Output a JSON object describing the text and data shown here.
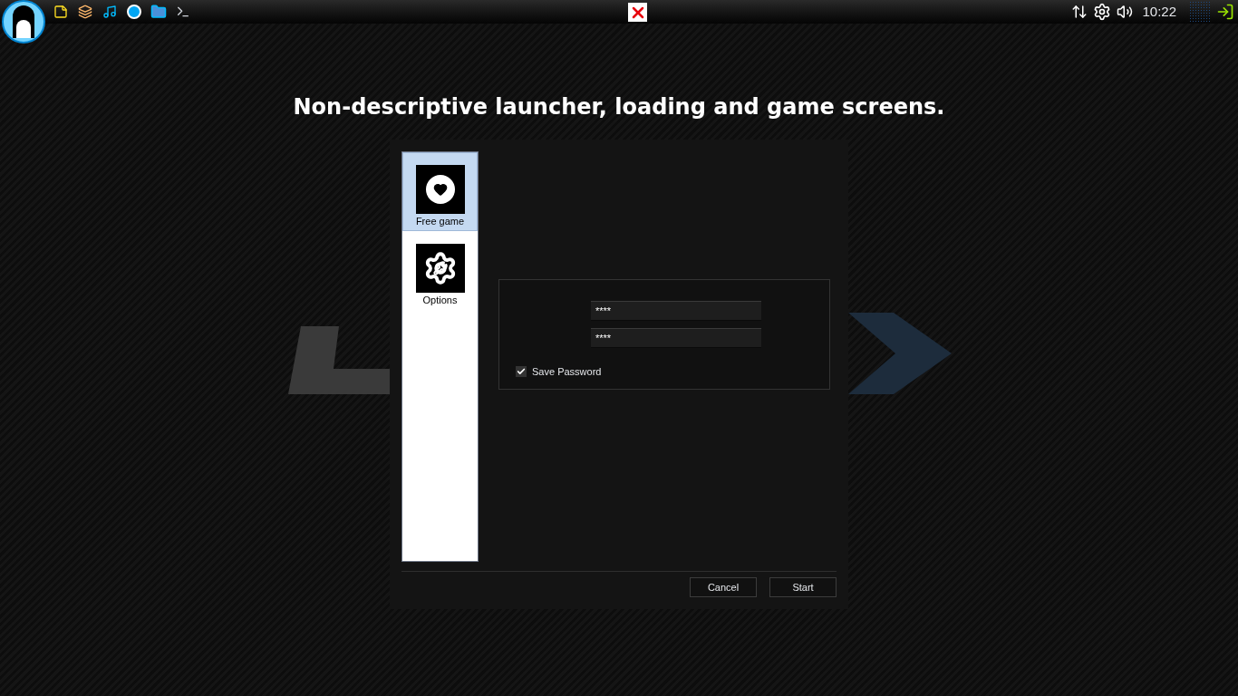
{
  "taskbar": {
    "clock": "10:22"
  },
  "heading": "Non-descriptive launcher, loading and game screens.",
  "launcher": {
    "sidebar": [
      {
        "label": "Free game",
        "kind": "heart",
        "selected": true
      },
      {
        "label": "Options",
        "kind": "gear",
        "selected": false
      }
    ],
    "fields": [
      {
        "value": "****"
      },
      {
        "value": "****"
      }
    ],
    "save_password": {
      "label": "Save Password",
      "checked": true
    },
    "buttons": [
      "Cancel",
      "Start"
    ]
  }
}
